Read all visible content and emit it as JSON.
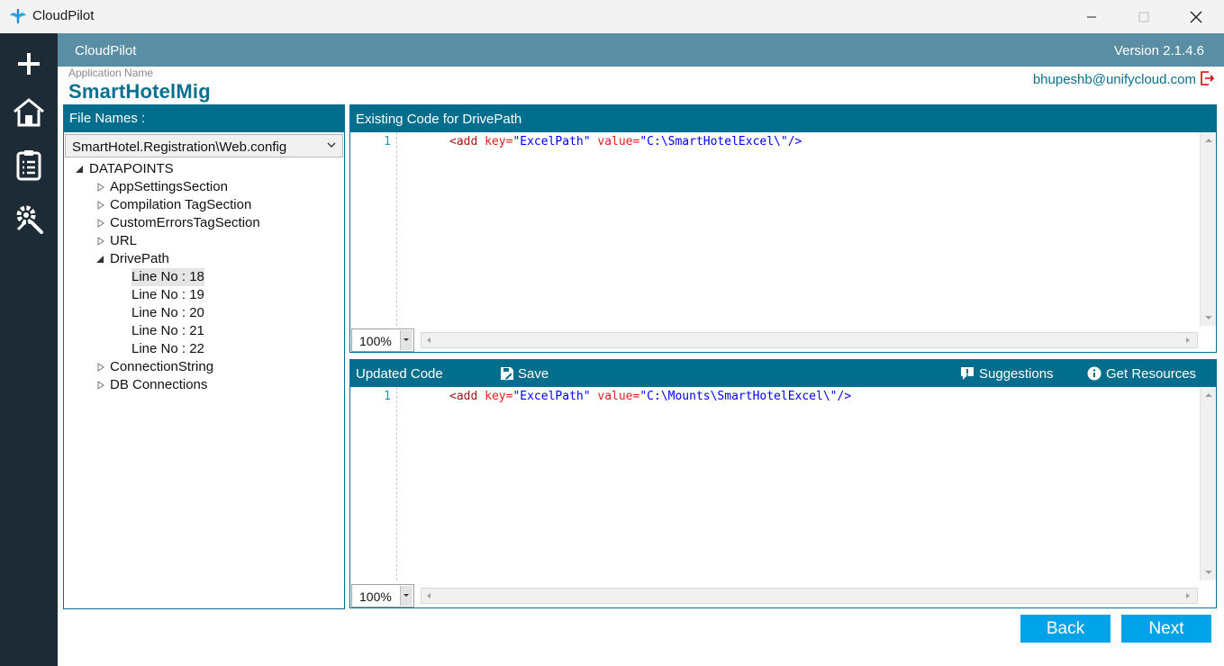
{
  "window": {
    "title": "CloudPilot",
    "minimize": "—",
    "maximize": "☐",
    "close": "✕"
  },
  "header": {
    "title": "CloudPilot",
    "version": "Version 2.1.4.6"
  },
  "application": {
    "label": "Application Name",
    "name": "SmartHotelMig"
  },
  "user": {
    "email": "bhupeshb@unifycloud.com"
  },
  "sidebar": {
    "icons": [
      "plus-icon",
      "home-icon",
      "document-list-icon",
      "settings-wrench-icon"
    ]
  },
  "files": {
    "header": "File Names :",
    "selected_file": "SmartHotel.Registration\\Web.config",
    "tree": {
      "root": "DATAPOINTS",
      "nodes": [
        "AppSettingsSection",
        "Compilation TagSection",
        "CustomErrorsTagSection",
        "URL",
        "DrivePath",
        "ConnectionString",
        "DB Connections"
      ],
      "drivepath_children": [
        "Line No : 18",
        "Line No : 19",
        "Line No : 20",
        "Line No : 21",
        "Line No : 22"
      ],
      "selected": "Line No : 18"
    }
  },
  "existing": {
    "title": "Existing Code for DrivePath",
    "line_no": "1",
    "tokens": {
      "tag_open": "<add",
      "attr1": "key=",
      "val1": "\"ExcelPath\"",
      "attr2": "value=",
      "val2": "\"C:\\SmartHotelExcel\\\"",
      "tag_close": "/>"
    },
    "zoom": "100%"
  },
  "updated": {
    "title": "Updated Code",
    "save": "Save",
    "suggestions": "Suggestions",
    "get_resources": "Get Resources",
    "line_no": "1",
    "tokens": {
      "tag_open": "<add",
      "attr1": "key=",
      "val1": "\"ExcelPath\"",
      "attr2": "value=",
      "val2": "\"C:\\Mounts\\SmartHotelExcel\\\"",
      "tag_close": "/>"
    },
    "zoom": "100%"
  },
  "nav": {
    "back": "Back",
    "next": "Next"
  },
  "colors": {
    "rail": "#1c2b35",
    "header": "#5a8ea4",
    "panel_header": "#006e8c",
    "accent_button": "#00a2e8",
    "brand_text": "#0b6f8f"
  }
}
